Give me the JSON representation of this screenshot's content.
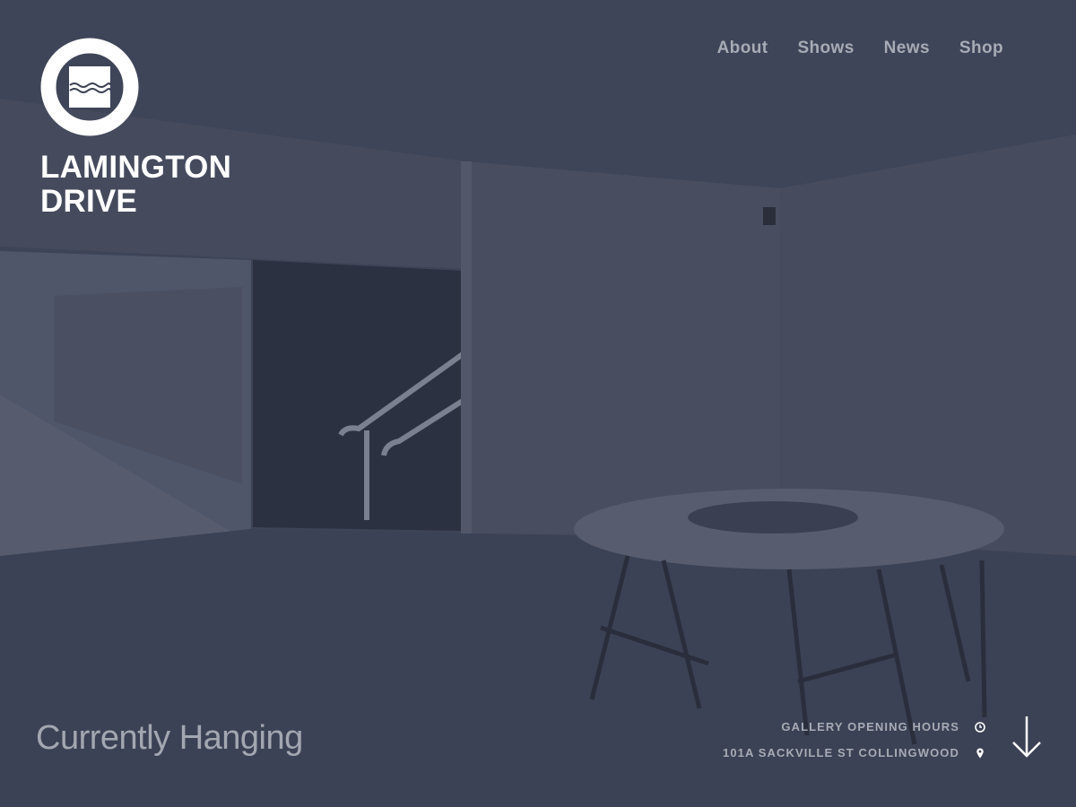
{
  "site": {
    "logo_line1": "LAMINGTON",
    "logo_line2": "DRIVE"
  },
  "nav": {
    "items": [
      {
        "label": "About"
      },
      {
        "label": "Shows"
      },
      {
        "label": "News"
      },
      {
        "label": "Shop"
      }
    ]
  },
  "hero": {
    "headline": "Currently Hanging",
    "info": {
      "hours_label": "GALLERY OPENING HOURS",
      "hours_icon": "clock-icon",
      "address_label": "101A SACKVILLE ST COLLINGWOOD",
      "address_icon": "map-pin-icon"
    },
    "scroll_icon": "arrow-down-icon"
  },
  "colors": {
    "overlay": "#3b4154",
    "nav_text": "#a7abb5",
    "logo": "#ffffff"
  }
}
